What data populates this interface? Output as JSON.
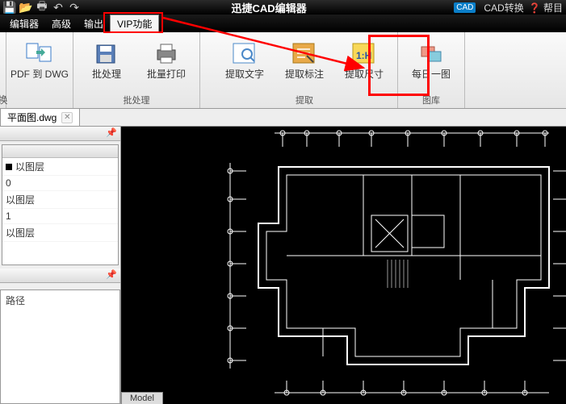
{
  "app": {
    "title": "迅捷CAD编辑器",
    "cad_badge": "CAD",
    "cad_convert": "CAD转换",
    "help": "帮目"
  },
  "menu": {
    "editor": "编辑器",
    "advanced": "高级",
    "output": "输出",
    "vip": "VIP功能"
  },
  "ribbon": {
    "left_stub": "换",
    "pdf_to_dwg": "PDF 到 DWG",
    "batch": "批处理",
    "batch_print": "批量打印",
    "group_batch": "批处理",
    "extract_text": "提取文字",
    "extract_annot": "提取标注",
    "extract_dim": "提取尺寸",
    "group_extract": "提取",
    "daily_img": "每日一图",
    "group_gallery": "图库"
  },
  "file_tab": {
    "name": "平面图.dwg"
  },
  "layers": {
    "rows": [
      "以图层",
      "0",
      "以图层",
      "1",
      "以图层"
    ]
  },
  "path_panel": {
    "label": "路径"
  },
  "bottom_tab": {
    "model": "Model"
  }
}
